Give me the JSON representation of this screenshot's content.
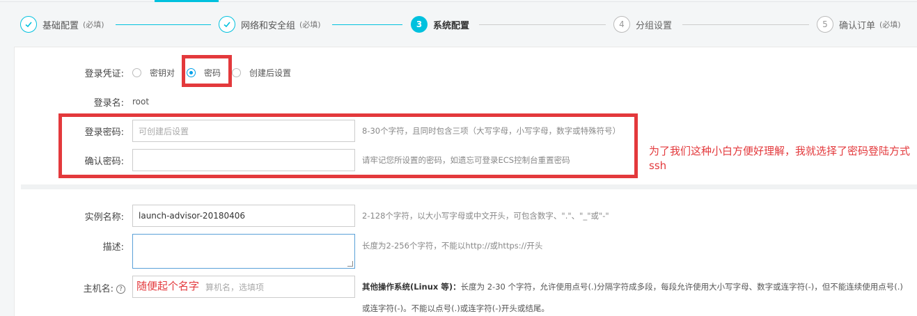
{
  "stepper": {
    "steps": [
      {
        "num": "✓",
        "title": "基础配置",
        "req": "(必填)"
      },
      {
        "num": "✓",
        "title": "网络和安全组",
        "req": "(必填)"
      },
      {
        "num": "3",
        "title": "系统配置",
        "req": ""
      },
      {
        "num": "4",
        "title": "分组设置",
        "req": ""
      },
      {
        "num": "5",
        "title": "确认订单",
        "req": "(必填)"
      }
    ]
  },
  "credential": {
    "label": "登录凭证:",
    "options": [
      "密钥对",
      "密码",
      "创建后设置"
    ],
    "selected": "密码"
  },
  "login_name": {
    "label": "登录名:",
    "value": "root"
  },
  "password": {
    "label": "登录密码:",
    "placeholder": "可创建后设置",
    "hint": "8-30个字符，且同时包含三项（大写字母，小写字母，数字或特殊符号）"
  },
  "confirm_password": {
    "label": "确认密码:",
    "hint": "请牢记您所设置的密码，如遗忘可登录ECS控制台重置密码"
  },
  "annotation_password": "为了我们这种小白方便好理解，我就选择了密码登陆方式ssh",
  "instance_name": {
    "label": "实例名称:",
    "value": "launch-advisor-20180406",
    "hint": "2-128个字符，以大小写字母或中文开头，可包含数字、\".\"、\"_\"或\"-\""
  },
  "description": {
    "label": "描述:",
    "hint": "长度为2-256个字符，不能以http://或https://开头"
  },
  "hostname": {
    "label": "主机名:",
    "help": "?",
    "placeholder": "算机名，选填项",
    "annotation": "随便起个名字",
    "hint_bold": "其他操作系统(Linux 等)：",
    "hint": "长度为 2-30 个字符，允许使用点号(.)分隔字符成多段，每段允许使用大小写字母、数字或连字符(-)，但不能连续使用点号(.)",
    "hint2": "或连字符(-)。不能以点号(.)或连字符(-)开头或结尾。"
  },
  "colors": {
    "accent": "#00c1de",
    "annotation": "#e3393c"
  }
}
